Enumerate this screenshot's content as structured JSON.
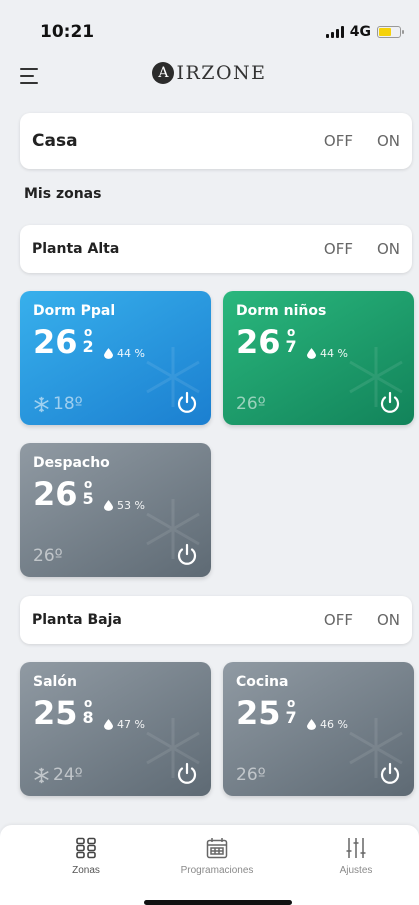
{
  "status_bar": {
    "time": "10:21",
    "network": "4G"
  },
  "brand": {
    "logo_letter": "A",
    "text": "IRZONE"
  },
  "casa": {
    "title": "Casa",
    "off_label": "OFF",
    "on_label": "ON"
  },
  "section_label": "Mis zonas",
  "groups": [
    {
      "title": "Planta Alta",
      "off_label": "OFF",
      "on_label": "ON"
    },
    {
      "title": "Planta Baja",
      "off_label": "OFF",
      "on_label": "ON"
    }
  ],
  "zones": [
    {
      "name": "Dorm Ppal",
      "temp_int": "26",
      "temp_deg": "o",
      "temp_dec": "2",
      "humidity": "44 %",
      "setpoint": "18º",
      "mode_icon": "snowflake-icon",
      "color": "#2a97e0"
    },
    {
      "name": "Dorm niños",
      "temp_int": "26",
      "temp_deg": "o",
      "temp_dec": "7",
      "humidity": "44 %",
      "setpoint": "26º",
      "color": "#1c9e6c"
    },
    {
      "name": "Despacho",
      "temp_int": "26",
      "temp_deg": "o",
      "temp_dec": "5",
      "humidity": "53 %",
      "setpoint": "26º",
      "color": "#77828c"
    },
    {
      "name": "Salón",
      "temp_int": "25",
      "temp_deg": "o",
      "temp_dec": "8",
      "humidity": "47 %",
      "setpoint": "24º",
      "mode_icon": "snowflake-icon",
      "color": "#77828c"
    },
    {
      "name": "Cocina",
      "temp_int": "25",
      "temp_deg": "o",
      "temp_dec": "7",
      "humidity": "46 %",
      "setpoint": "26º",
      "color": "#77828c"
    }
  ],
  "nav": [
    {
      "label": "Zonas",
      "icon": "grid-icon",
      "active": true
    },
    {
      "label": "Programaciones",
      "icon": "calendar-icon"
    },
    {
      "label": "Ajustes",
      "icon": "sliders-icon"
    }
  ]
}
